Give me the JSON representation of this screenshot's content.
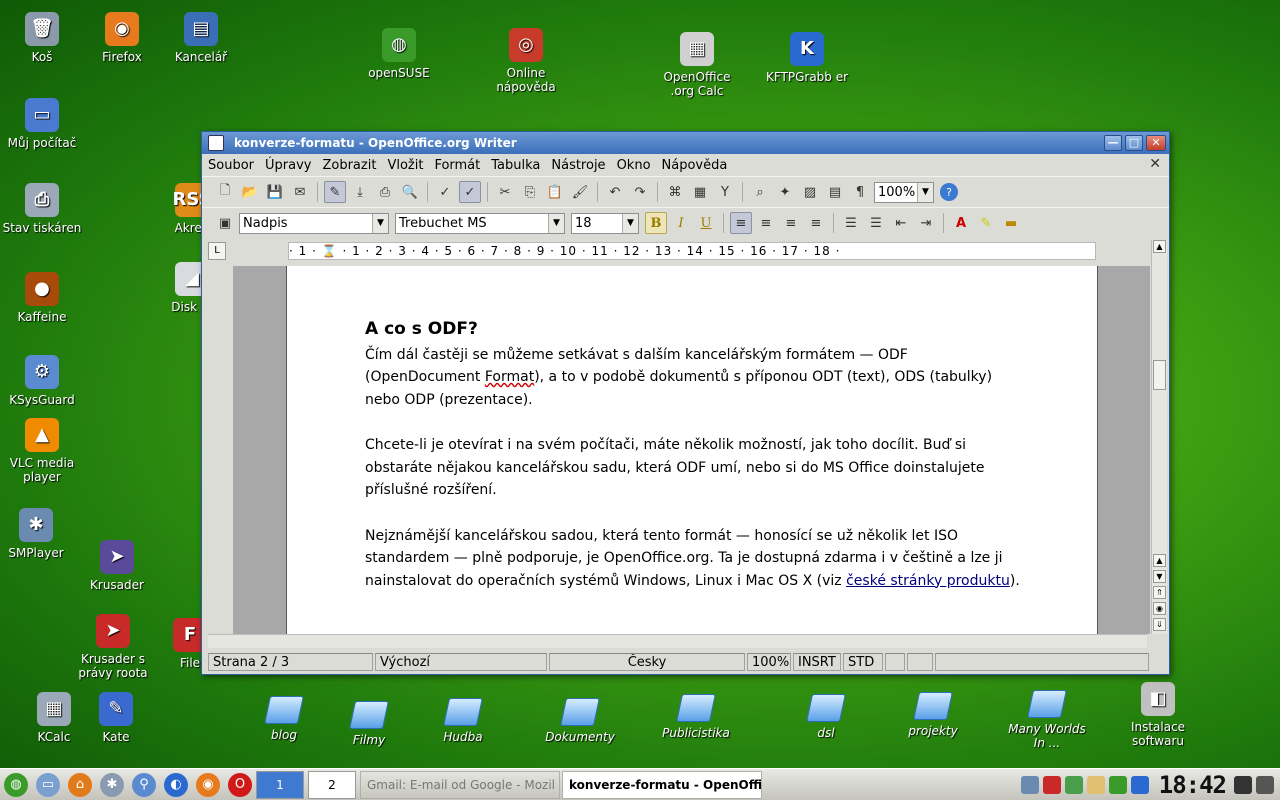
{
  "desktop_icons": [
    {
      "id": "kos",
      "label": "Koš",
      "glyph": "🗑",
      "color": "#8a9aaa"
    },
    {
      "id": "firefox",
      "label": "Firefox",
      "glyph": "◉",
      "color": "#e67a1c"
    },
    {
      "id": "kancelar",
      "label": "Kancelář",
      "glyph": "▤",
      "color": "#3a6fb8"
    },
    {
      "id": "opensuse",
      "label": "openSUSE",
      "glyph": "◍",
      "color": "#3a9a2a"
    },
    {
      "id": "online-napoveda",
      "label": "Online nápověda",
      "glyph": "◎",
      "color": "#c83a2a"
    },
    {
      "id": "oo-calc",
      "label": "OpenOffice .org Calc",
      "glyph": "▦",
      "color": "#d0d0d0"
    },
    {
      "id": "kftpgrabber",
      "label": "KFTPGrabb er",
      "glyph": "K",
      "color": "#2a6ad0"
    },
    {
      "id": "muj-pocitac",
      "label": "Můj počítač",
      "glyph": "▭",
      "color": "#4a7ad0"
    },
    {
      "id": "stav-tiskaren",
      "label": "Stav tiskáren",
      "glyph": "⎙",
      "color": "#9aa8b8"
    },
    {
      "id": "akreg",
      "label": "Akreg",
      "glyph": "RSS",
      "color": "#e08a1a"
    },
    {
      "id": "disk",
      "label": "Disk W",
      "glyph": "◢",
      "color": "#d8dce0"
    },
    {
      "id": "kaffeine",
      "label": "Kaffeine",
      "glyph": "●",
      "color": "#a84a0a"
    },
    {
      "id": "ksysguard",
      "label": "KSysGuard",
      "glyph": "⚙",
      "color": "#5a8ad0"
    },
    {
      "id": "vlc",
      "label": "VLC media player",
      "glyph": "▲",
      "color": "#f08a00"
    },
    {
      "id": "smplayer",
      "label": "SMPlayer",
      "glyph": "✱",
      "color": "#6a8ab0"
    },
    {
      "id": "krusader",
      "label": "Krusader",
      "glyph": "➤",
      "color": "#5a4a9a"
    },
    {
      "id": "krusader-root",
      "label": "Krusader s právy roota",
      "glyph": "➤",
      "color": "#c82a2a"
    },
    {
      "id": "file",
      "label": "File",
      "glyph": "F",
      "color": "#c82a2a"
    },
    {
      "id": "kcalc",
      "label": "KCalc",
      "glyph": "▦",
      "color": "#9aa8b8"
    },
    {
      "id": "kate",
      "label": "Kate",
      "glyph": "✎",
      "color": "#3a6ad0"
    },
    {
      "id": "instalace",
      "label": "Instalace softwaru",
      "glyph": "◧",
      "color": "#c0c0c0"
    }
  ],
  "folders": [
    {
      "id": "blog",
      "label": "blog"
    },
    {
      "id": "filmy",
      "label": "Filmy"
    },
    {
      "id": "hudba",
      "label": "Hudba"
    },
    {
      "id": "dokumenty",
      "label": "Dokumenty"
    },
    {
      "id": "publicistika",
      "label": "Publicistika"
    },
    {
      "id": "dsl",
      "label": "dsl"
    },
    {
      "id": "projekty",
      "label": "projekty"
    },
    {
      "id": "many-worlds",
      "label": "Many Worlds In ..."
    }
  ],
  "window": {
    "title": "konverze-formatu - OpenOffice.org Writer",
    "btn_min": "—",
    "btn_max": "□",
    "btn_close": "✕",
    "doc_close": "✕"
  },
  "menu": [
    "Soubor",
    "Úpravy",
    "Zobrazit",
    "Vložit",
    "Formát",
    "Tabulka",
    "Nástroje",
    "Okno",
    "Nápověda"
  ],
  "toolbar": {
    "zoom": "100%",
    "style": "Nadpis",
    "font": "Trebuchet MS",
    "size": "18",
    "bold": "B",
    "italic": "I",
    "underline": "U"
  },
  "ruler": {
    "tab_selector": "L",
    "marks": "· 1 · ⌛ · 1 · 2 · 3 · 4 · 5 · 6 · 7 · 8 · 9 · 10 · 11 · 12 · 13 · 14 · 15 · 16 · 17 · 18 ·"
  },
  "document": {
    "heading": "A co s ODF?",
    "p1_a": "Čím dál častěji se můžeme setkávat s dalším kancelářským formátem — ODF (OpenDocument ",
    "p1_spell": "Format",
    "p1_b": "), a to v podobě dokumentů s příponou ODT (text), ODS (tabulky) nebo ODP (prezentace).",
    "p2": "Chcete-li je otevírat i na svém počítači, máte několik možností, jak toho docílit. Buď si obstaráte nějakou kancelářskou sadu, která ODF umí, nebo si do MS Office doinstalujete příslušné rozšíření.",
    "p3_a": "Nejznámější kancelářskou sadou, která tento formát — honosící se už několik let ISO standardem — plně podporuje, je OpenOffice.org. Ta je dostupná zdarma i v češtině a lze ji nainstalovat do operačních systémů Windows, Linux i Mac OS X (viz ",
    "p3_link": "české stránky produktu",
    "p3_b": ")."
  },
  "status": {
    "page": "Strana 2 / 3",
    "style": "Výchozí",
    "language": "Česky",
    "zoom": "100%",
    "insert": "INSRT",
    "selection": "STD"
  },
  "taskbar": {
    "pager_1": "1",
    "pager_2": "2",
    "task_gmail": "Gmail: E-mail od Google - Mozil",
    "task_writer": "konverze-formatu - OpenOffice",
    "clock": "18:42"
  }
}
